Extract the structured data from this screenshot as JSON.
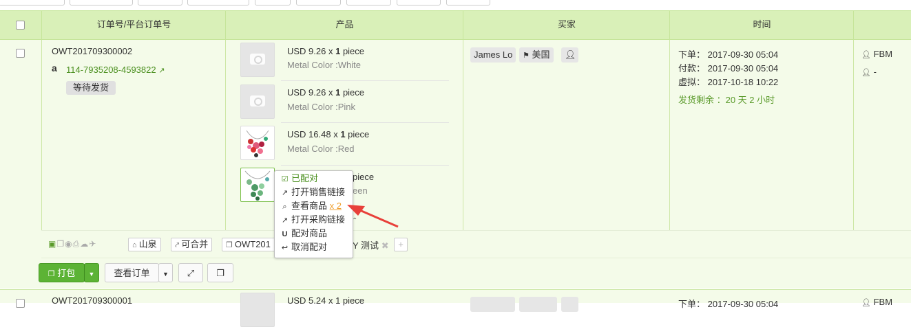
{
  "table": {
    "headers": {
      "order": "订单号/平台订单号",
      "product": "产品",
      "buyer": "买家",
      "time": "时间"
    }
  },
  "order1": {
    "order_no": "OWT201709300002",
    "platform_order_no": "114-7935208-4593822",
    "status": "等待发货",
    "products": [
      {
        "price": "USD 9.26 x ",
        "qty": "1",
        "unit": " piece",
        "variant": "Metal Color :White",
        "image": "camera-placeholder"
      },
      {
        "price": "USD 9.26 x ",
        "qty": "1",
        "unit": " piece",
        "variant": "Metal Color :Pink",
        "image": "camera-placeholder"
      },
      {
        "price": "USD 16.48 x ",
        "qty": "1",
        "unit": " piece",
        "variant": "Metal Color :Red",
        "image": "red-necklace"
      },
      {
        "price_tail": "piece",
        "variant_tail": "een",
        "image": "green-necklace"
      }
    ],
    "buyer_name": "James Lo",
    "buyer_country": "美国",
    "times": {
      "order_label": "下单：",
      "order_time": "2017-09-30 05:04",
      "paid_label": "付款：",
      "paid_time": "2017-09-30 05:04",
      "virtual_label": "虚拟：",
      "virtual_time": "2017-10-18 10:22",
      "remaining": "发货剩余 ：20 天 2 小时"
    },
    "fulfillment": "FBM",
    "assignee": "-",
    "tags": {
      "warehouse": "山泉",
      "mergeable": "可合并",
      "copy_order": "OWT201",
      "test_tag": "Y 测试"
    }
  },
  "popup_menu": {
    "paired": "已配对",
    "open_sale_link": "打开销售链接",
    "view_product": "查看商品",
    "view_count": "x 2",
    "open_purchase_link": "打开采购链接",
    "pair_product": "配对商品",
    "cancel_pair": "取消配对"
  },
  "actions": {
    "pack": "打包",
    "view_order": "查看订单"
  },
  "order2": {
    "order_no": "OWT201709300001",
    "price": "USD 5.24 x 1 piece",
    "order_label": "下单：",
    "order_time": "2017-09-30 05:04",
    "fulfillment": "FBM"
  },
  "colors": {
    "header_bg": "#d9f0b8",
    "row_bg": "#f4fbe9",
    "link_green": "#4a8f1e",
    "button_green": "#5cb335",
    "highlight_orange": "#f0a030",
    "arrow_red": "#e8403a"
  }
}
